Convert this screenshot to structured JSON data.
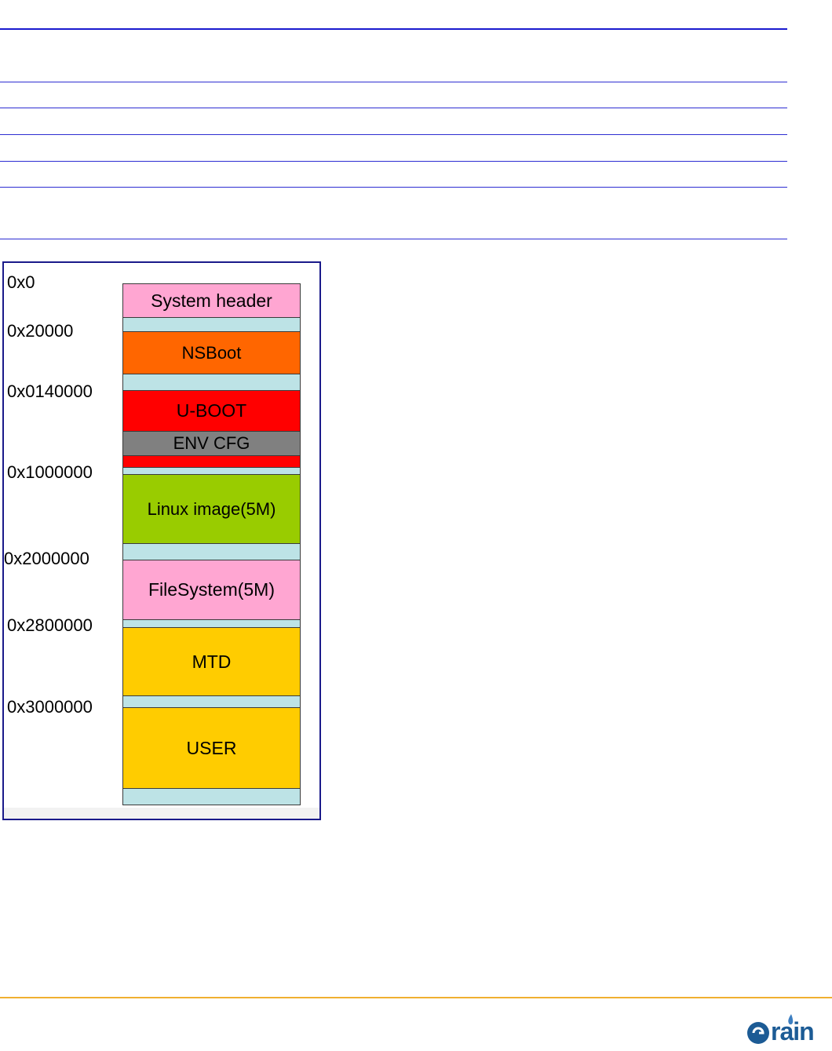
{
  "diagram": {
    "addresses": [
      "0x0",
      "0x20000",
      "0x0140000",
      "0x1000000",
      "0x2000000",
      "0x2800000",
      "0x3000000"
    ],
    "blocks": [
      {
        "label": "System header",
        "color": "#ffa6d2"
      },
      {
        "label": "NSBoot",
        "color": "#ff6600"
      },
      {
        "label": "U-BOOT",
        "color": "#ff0000"
      },
      {
        "label": "ENV CFG",
        "color": "#808080"
      },
      {
        "label": "Linux image(5M)",
        "color": "#99cc00"
      },
      {
        "label": "FileSystem(5M)",
        "color": "#ffa6d2"
      },
      {
        "label": "MTD",
        "color": "#ffcc00"
      },
      {
        "label": "USER",
        "color": "#ffcc00"
      }
    ],
    "gap_color": "#bde3e6",
    "frame_color": "#1a1a8a"
  },
  "footer": {
    "logo_text": "rain",
    "logo_color": "#1c5b95",
    "rule_color": "#f0b030"
  }
}
